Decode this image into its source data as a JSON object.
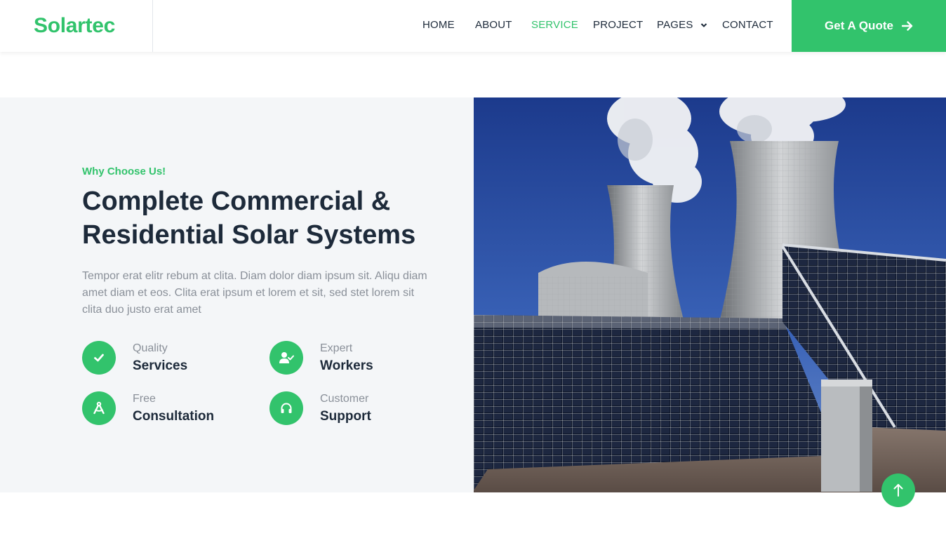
{
  "brand": {
    "name": "Solartec"
  },
  "nav": {
    "items": [
      {
        "label": "HOME"
      },
      {
        "label": "ABOUT"
      },
      {
        "label": "SERVICE"
      },
      {
        "label": "PROJECT"
      },
      {
        "label": "PAGES"
      },
      {
        "label": "CONTACT"
      }
    ],
    "active": "SERVICE",
    "cta_label": "Get A Quote"
  },
  "section": {
    "eyebrow": "Why Choose Us!",
    "title_line1": "Complete Commercial &",
    "title_line2": "Residential Solar Systems",
    "body": "Tempor erat elitr rebum at clita. Diam dolor diam ipsum sit. Aliqu diam amet diam et eos. Clita erat ipsum et lorem et sit, sed stet lorem sit clita duo justo erat amet",
    "features": [
      {
        "small": "Quality",
        "big": "Services",
        "icon": "check-icon"
      },
      {
        "small": "Expert",
        "big": "Workers",
        "icon": "user-check-icon"
      },
      {
        "small": "Free",
        "big": "Consultation",
        "icon": "drafting-compass-icon"
      },
      {
        "small": "Customer",
        "big": "Support",
        "icon": "headphones-icon"
      }
    ]
  },
  "colors": {
    "accent": "#32c36c",
    "dark": "#1d2a3a",
    "muted": "#8a9099",
    "panel": "#f4f6f8"
  }
}
